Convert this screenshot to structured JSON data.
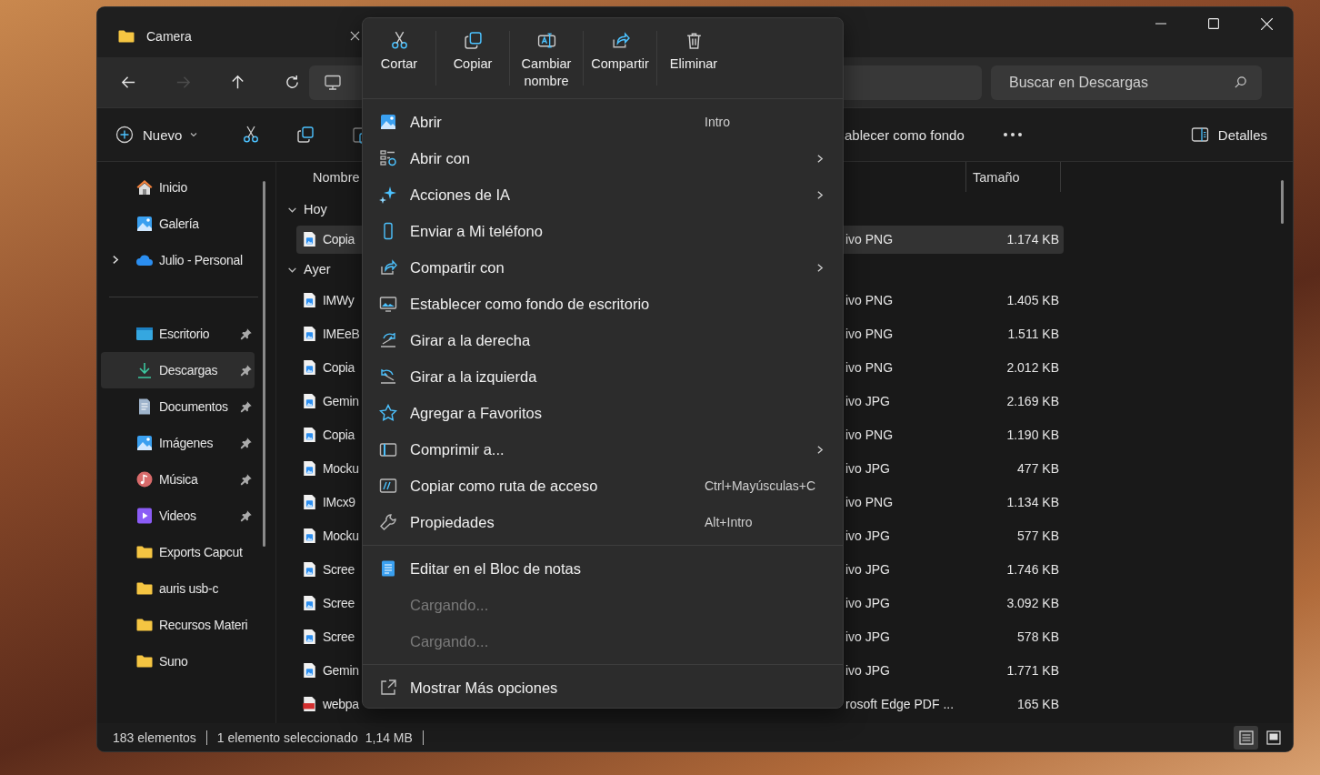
{
  "window": {
    "tab_title": "Camera"
  },
  "navigation": {
    "buttons": [
      {
        "disabled": false
      },
      {
        "disabled": true
      },
      {
        "disabled": false
      },
      {
        "disabled": false
      }
    ],
    "search": {
      "placeholder": "Buscar en Descargas"
    }
  },
  "command_bar": {
    "new_label": "Nuevo",
    "set_background_label": "ablecer como fondo",
    "details_label": "Detalles"
  },
  "sidebar": {
    "groups": [
      [
        {
          "label": "Inicio",
          "selected": false,
          "pinned": false,
          "expandable": false
        },
        {
          "label": "Galería",
          "selected": false,
          "pinned": false,
          "expandable": false
        },
        {
          "label": "Julio - Personal",
          "selected": false,
          "pinned": false,
          "expandable": true
        }
      ],
      [
        {
          "label": "Escritorio",
          "selected": false,
          "pinned": true,
          "expandable": false
        },
        {
          "label": "Descargas",
          "selected": true,
          "pinned": true,
          "expandable": false
        },
        {
          "label": "Documentos",
          "selected": false,
          "pinned": true,
          "expandable": false
        },
        {
          "label": "Imágenes",
          "selected": false,
          "pinned": true,
          "expandable": false
        },
        {
          "label": "Música",
          "selected": false,
          "pinned": true,
          "expandable": false
        },
        {
          "label": "Videos",
          "selected": false,
          "pinned": true,
          "expandable": false
        },
        {
          "label": "Exports Capcut",
          "selected": false,
          "pinned": false,
          "expandable": false
        },
        {
          "label": "auris usb-c",
          "selected": false,
          "pinned": false,
          "expandable": false
        },
        {
          "label": "Recursos Materi",
          "selected": false,
          "pinned": false,
          "expandable": false
        },
        {
          "label": "Suno",
          "selected": false,
          "pinned": false,
          "expandable": false
        }
      ]
    ]
  },
  "file_list": {
    "columns": [
      "Nombre",
      "Tamaño"
    ],
    "groups": [
      {
        "label": "Hoy",
        "expanded": true,
        "rows": [
          {
            "name": "Copia",
            "type": "ivo PNG",
            "size": "1.174 KB",
            "kind": "image",
            "selected": true
          }
        ]
      },
      {
        "label": "Ayer",
        "expanded": true,
        "rows": [
          {
            "name": "IMWy",
            "type": "ivo PNG",
            "size": "1.405 KB",
            "kind": "image",
            "selected": false
          },
          {
            "name": "IMEeB",
            "type": "ivo PNG",
            "size": "1.511 KB",
            "kind": "image",
            "selected": false
          },
          {
            "name": "Copia",
            "type": "ivo PNG",
            "size": "2.012 KB",
            "kind": "image",
            "selected": false
          },
          {
            "name": "Gemin",
            "type": "ivo JPG",
            "size": "2.169 KB",
            "kind": "image",
            "selected": false
          },
          {
            "name": "Copia",
            "type": "ivo PNG",
            "size": "1.190 KB",
            "kind": "image",
            "selected": false
          },
          {
            "name": "Mocku",
            "type": "ivo JPG",
            "size": "477 KB",
            "kind": "image",
            "selected": false
          },
          {
            "name": "IMcx9",
            "type": "ivo PNG",
            "size": "1.134 KB",
            "kind": "image",
            "selected": false
          },
          {
            "name": "Mocku",
            "type": "ivo JPG",
            "size": "577 KB",
            "kind": "image",
            "selected": false
          },
          {
            "name": "Scree",
            "type": "ivo JPG",
            "size": "1.746 KB",
            "kind": "image",
            "selected": false
          },
          {
            "name": "Scree",
            "type": "ivo JPG",
            "size": "3.092 KB",
            "kind": "image",
            "selected": false
          },
          {
            "name": "Scree",
            "type": "ivo JPG",
            "size": "578 KB",
            "kind": "image",
            "selected": false
          },
          {
            "name": "Gemin",
            "type": "ivo JPG",
            "size": "1.771 KB",
            "kind": "image",
            "selected": false
          },
          {
            "name": "webpa",
            "type": "rosoft Edge PDF ...",
            "size": "165 KB",
            "kind": "pdf",
            "selected": false
          }
        ]
      }
    ]
  },
  "status_bar": {
    "count": "183 elementos",
    "selection": "1 elemento seleccionado",
    "selection_size": "1,14 MB",
    "views": [
      {
        "selected": true
      },
      {
        "selected": false
      }
    ]
  },
  "context_menu": {
    "actions": [
      {
        "label": "Cortar"
      },
      {
        "label": "Copiar"
      },
      {
        "label": "Cambiar nombre"
      },
      {
        "label": "Compartir"
      },
      {
        "label": "Eliminar"
      }
    ],
    "sections": [
      [
        {
          "label": "Abrir",
          "shortcut": "Intro",
          "submenu": false,
          "disabled": false
        },
        {
          "label": "Abrir con",
          "submenu": true,
          "disabled": false
        },
        {
          "label": "Acciones de IA",
          "submenu": true,
          "disabled": false
        },
        {
          "label": "Enviar a Mi teléfono",
          "submenu": false,
          "disabled": false
        },
        {
          "label": "Compartir con",
          "submenu": true,
          "disabled": false
        },
        {
          "label": "Establecer como fondo de escritorio",
          "submenu": false,
          "disabled": false
        },
        {
          "label": "Girar a la derecha",
          "submenu": false,
          "disabled": false
        },
        {
          "label": "Girar a la izquierda",
          "submenu": false,
          "disabled": false
        },
        {
          "label": "Agregar a Favoritos",
          "submenu": false,
          "disabled": false
        },
        {
          "label": "Comprimir a...",
          "submenu": true,
          "disabled": false
        },
        {
          "label": "Copiar como ruta de acceso",
          "shortcut": "Ctrl+Mayúsculas+C",
          "submenu": false,
          "disabled": false
        },
        {
          "label": "Propiedades",
          "shortcut": "Alt+Intro",
          "submenu": false,
          "disabled": false
        }
      ],
      [
        {
          "label": "Editar en el Bloc de notas",
          "submenu": false,
          "disabled": false
        },
        {
          "label": "Cargando...",
          "submenu": false,
          "disabled": true
        },
        {
          "label": "Cargando...",
          "submenu": false,
          "disabled": true
        }
      ],
      [
        {
          "label": "Mostrar Más opciones",
          "submenu": false,
          "disabled": false
        }
      ]
    ]
  }
}
